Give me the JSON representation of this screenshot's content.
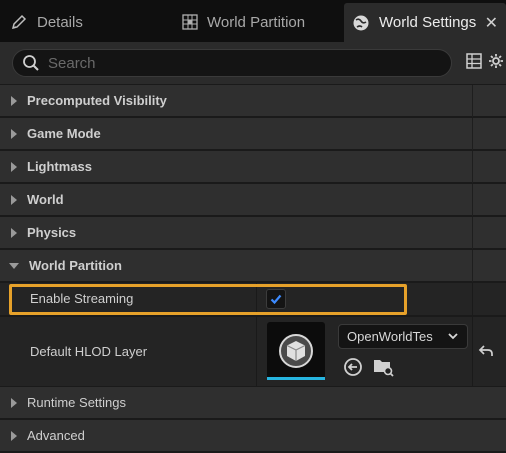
{
  "tabs": [
    {
      "label": "Details",
      "icon": "pencil-icon",
      "active": false
    },
    {
      "label": "World Partition",
      "icon": "grid-icon",
      "active": false
    },
    {
      "label": "World Settings",
      "icon": "globe-icon",
      "active": true
    }
  ],
  "tab_close_glyph": "✕",
  "search": {
    "placeholder": "Search",
    "value": ""
  },
  "categories": [
    {
      "label": "Precomputed Visibility",
      "expanded": false
    },
    {
      "label": "Game Mode",
      "expanded": false
    },
    {
      "label": "Lightmass",
      "expanded": false
    },
    {
      "label": "World",
      "expanded": false
    },
    {
      "label": "Physics",
      "expanded": false
    },
    {
      "label": "World Partition",
      "expanded": true
    },
    {
      "label": "Runtime Settings",
      "expanded": false
    },
    {
      "label": "Advanced",
      "expanded": false
    }
  ],
  "properties": {
    "enable_streaming": {
      "label": "Enable Streaming",
      "checked": true
    },
    "default_hlod_layer": {
      "label": "Default HLOD Layer",
      "asset_value": "OpenWorldTes"
    }
  },
  "colors": {
    "highlight": "#e6a12a",
    "accent": "#26b5e0",
    "checkmark": "#3d8bff"
  }
}
